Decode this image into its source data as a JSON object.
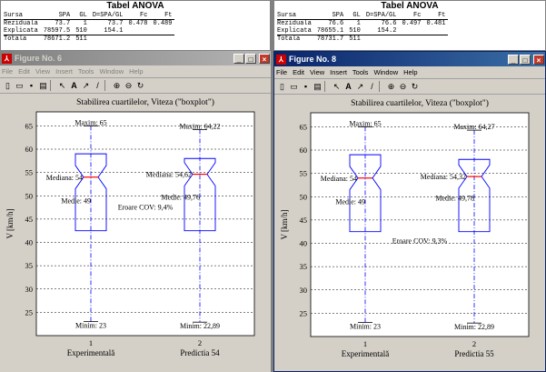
{
  "anova_tables": [
    {
      "title": "Tabel ANOVA",
      "headers": [
        "Sursa",
        "SPA",
        "GL",
        "D=SPA/GL",
        "Fc",
        "Ft"
      ],
      "rows": [
        [
          "Reziduala",
          "73.7",
          "1",
          "73.7",
          "0.478",
          "0.489"
        ],
        [
          "Explicata",
          "78597.5",
          "510",
          "154.1",
          "",
          ""
        ],
        [
          "Totala",
          "78671.2",
          "511",
          "",
          "",
          ""
        ]
      ]
    },
    {
      "title": "Tabel ANOVA",
      "headers": [
        "Sursa",
        "SPA",
        "GL",
        "D=SPA/GL",
        "Fc",
        "Ft"
      ],
      "rows": [
        [
          "Reziduala",
          "76.6",
          "1",
          "76.6",
          "0.497",
          "0.481"
        ],
        [
          "Explicata",
          "78655.1",
          "510",
          "154.2",
          "",
          ""
        ],
        [
          "Totala",
          "78731.7",
          "511",
          "",
          "",
          ""
        ]
      ]
    }
  ],
  "windows": [
    {
      "title": "Figure No. 6",
      "active": false,
      "menu": [
        "File",
        "Edit",
        "View",
        "Insert",
        "Tools",
        "Window",
        "Help"
      ],
      "buttons": {
        "minimize": "_",
        "maximize": "□",
        "close": "×"
      }
    },
    {
      "title": "Figure No. 8",
      "active": true,
      "menu": [
        "File",
        "Edit",
        "View",
        "Insert",
        "Tools",
        "Window",
        "Help"
      ],
      "buttons": {
        "minimize": "_",
        "maximize": "□",
        "close": "×"
      }
    }
  ],
  "toolbar_icons": [
    "new-file-icon",
    "open-folder-icon",
    "save-icon",
    "print-icon",
    "arrow-pointer-icon",
    "text-tool-icon",
    "arrow-tool-icon",
    "line-tool-icon",
    "zoom-in-icon",
    "zoom-out-icon",
    "rotate-icon"
  ],
  "colors": {
    "box": "#0000ff",
    "median": "#ff0000",
    "whisker": "#0000ff",
    "titlebar_active": "#0a246a"
  },
  "chart_data": [
    {
      "type": "boxplot",
      "title": "Stabilirea cuartilelor, Viteza (\"boxplot\")",
      "ylabel": "V [km/h]",
      "ylim": [
        20,
        68
      ],
      "yticks": [
        25,
        30,
        35,
        40,
        45,
        50,
        55,
        60,
        65
      ],
      "categories": [
        "Experimentală",
        "Predictia 54"
      ],
      "xtick_labels": [
        "1",
        "2"
      ],
      "boxes": [
        {
          "min": 23,
          "q1": 42.5,
          "median": 54,
          "q3": 59,
          "max": 65,
          "mean": 49,
          "labels": {
            "max": "Maxim: 65",
            "median": "Mediana: 54",
            "mean": "Medie: 49",
            "min": "Minim: 23"
          }
        },
        {
          "min": 22.89,
          "q1": 42.5,
          "median": 54.62,
          "q3": 58,
          "max": 64.22,
          "mean": 49.76,
          "labels": {
            "max": "Maxim: 64,22",
            "median": "Mediana: 54,62",
            "mean": "Medie: 49,76",
            "min": "Minim: 22,89"
          }
        }
      ],
      "annotation": {
        "text": "Eroare COV: 9,4%",
        "x": 1.5,
        "y": 47
      }
    },
    {
      "type": "boxplot",
      "title": "Stabilirea cuartilelor, Viteza (\"boxplot\")",
      "ylabel": "V [km/h]",
      "ylim": [
        20,
        68
      ],
      "yticks": [
        25,
        30,
        35,
        40,
        45,
        50,
        55,
        60,
        65
      ],
      "categories": [
        "Experimentală",
        "Predictia 55"
      ],
      "xtick_labels": [
        "1",
        "2"
      ],
      "boxes": [
        {
          "min": 23,
          "q1": 42.5,
          "median": 54,
          "q3": 59,
          "max": 65,
          "mean": 49,
          "labels": {
            "max": "Maxim: 65",
            "median": "Mediana: 54",
            "mean": "Medie: 49",
            "min": "Minim: 23"
          }
        },
        {
          "min": 22.89,
          "q1": 42.5,
          "median": 54.32,
          "q3": 58,
          "max": 64.27,
          "mean": 49.78,
          "labels": {
            "max": "Maxim: 64,27",
            "median": "Mediana: 54,32",
            "mean": "Medie: 49,78",
            "min": "Minim: 22,89"
          }
        }
      ],
      "annotation": {
        "text": "Eroare COV: 9,3%",
        "x": 1.5,
        "y": 40
      }
    }
  ]
}
